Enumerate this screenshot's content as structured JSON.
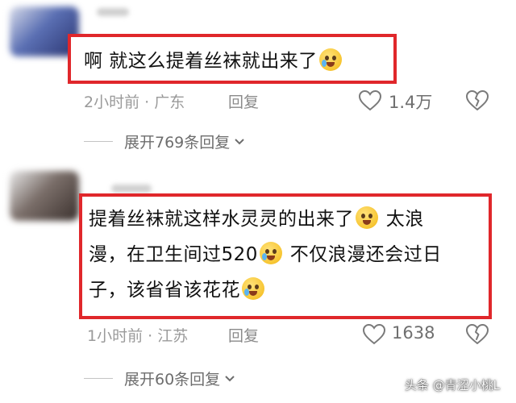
{
  "comments": [
    {
      "text": "啊 就这么提着丝袜就出来了",
      "emoji": "crying-laughing-emoji",
      "time_location": "2小时前 · 广东",
      "reply_label": "回复",
      "likes": "1.4万",
      "expand_label": "展开769条回复"
    },
    {
      "text_lines": [
        "提着丝袜就这样水灵灵的出来了",
        "漫，在卫生间过520",
        "子，该省省该花花"
      ],
      "text_after_emoji_line1": " 太浪",
      "text_after_emoji_line2": " 不仅浪漫还会过日",
      "time_location": "1小时前 · 江苏",
      "reply_label": "回复",
      "likes": "1638",
      "expand_label": "展开60条回复"
    }
  ],
  "watermark": "头条 @青涩小桃L",
  "colors": {
    "highlight_border": "#e0272b",
    "meta_text": "#9a9a9a",
    "like_text": "#6f6f6f"
  }
}
